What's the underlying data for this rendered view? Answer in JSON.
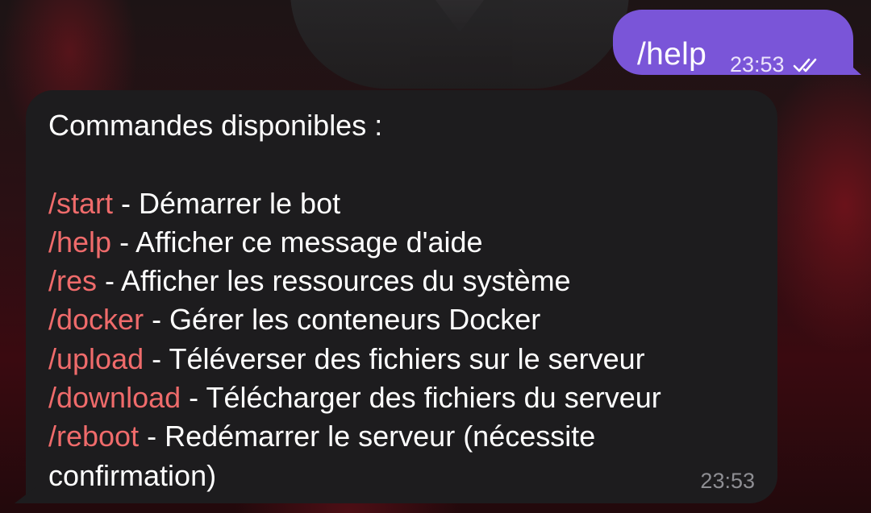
{
  "outgoing": {
    "text": "/help",
    "time": "23:53",
    "status_icon": "double-check-icon",
    "color": "#7a55d8"
  },
  "incoming": {
    "header": "Commandes disponibles :",
    "time": "23:53",
    "color": "#1d1c1e",
    "command_color": "#ef6b6b",
    "commands": [
      {
        "cmd": "/start",
        "desc": " - Démarrer le bot"
      },
      {
        "cmd": "/help",
        "desc": " - Afficher ce message d'aide"
      },
      {
        "cmd": "/res",
        "desc": " - Afficher les ressources du système"
      },
      {
        "cmd": "/docker",
        "desc": " - Gérer les conteneurs Docker"
      },
      {
        "cmd": "/upload",
        "desc": " - Téléverser des fichiers sur le serveur"
      },
      {
        "cmd": "/download",
        "desc": " - Télécharger des fichiers du serveur"
      },
      {
        "cmd": "/reboot",
        "desc": " - Redémarrer le serveur (nécessite confirmation)"
      }
    ]
  }
}
